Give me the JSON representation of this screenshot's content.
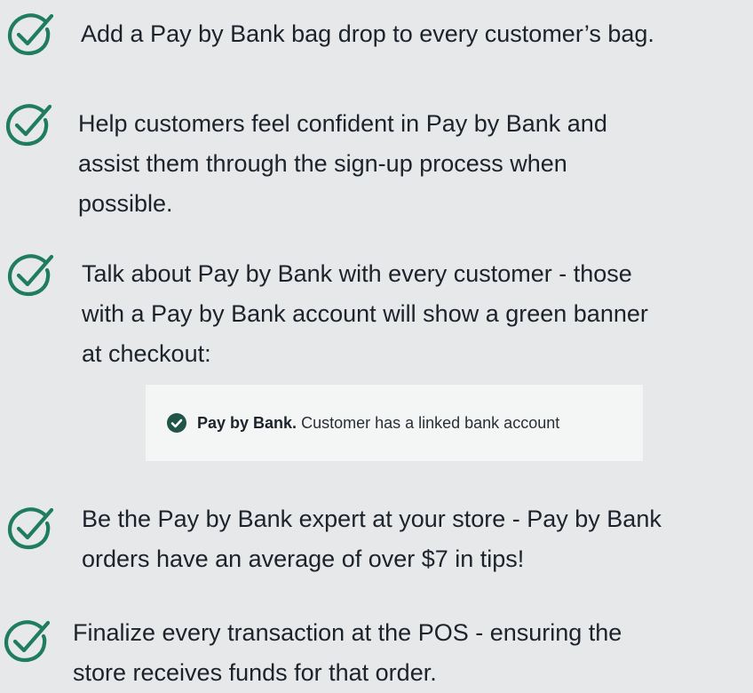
{
  "colors": {
    "background": "#e6e8ea",
    "accent": "#1f7d5e",
    "text": "#1d232b",
    "banner_background": "#f4f6f6",
    "banner_check": "#1f5547"
  },
  "checklist": [
    {
      "icon": "check-circle-icon",
      "lines": [
        "Add a Pay by Bank bag drop to every customer’s bag."
      ]
    },
    {
      "icon": "check-circle-icon",
      "lines": [
        "Help customers feel confident in Pay by Bank and",
        "assist them through the sign-up process when",
        "possible."
      ]
    },
    {
      "icon": "check-circle-icon",
      "lines": [
        "Talk about Pay by Bank with every customer - those",
        "with a Pay by Bank account will show a green banner",
        "at checkout:"
      ]
    },
    {
      "icon": "check-circle-icon",
      "lines": [
        "Be the Pay by Bank expert at your store - Pay by Bank",
        "orders have an average of over $7 in tips!"
      ]
    },
    {
      "icon": "check-circle-icon",
      "lines": [
        "Finalize every transaction at the POS - ensuring the",
        "store receives funds for that order."
      ]
    }
  ],
  "banner": {
    "icon": "check-circle-filled-icon",
    "bold": "Pay by Bank.",
    "text": " Customer has a linked bank account"
  }
}
